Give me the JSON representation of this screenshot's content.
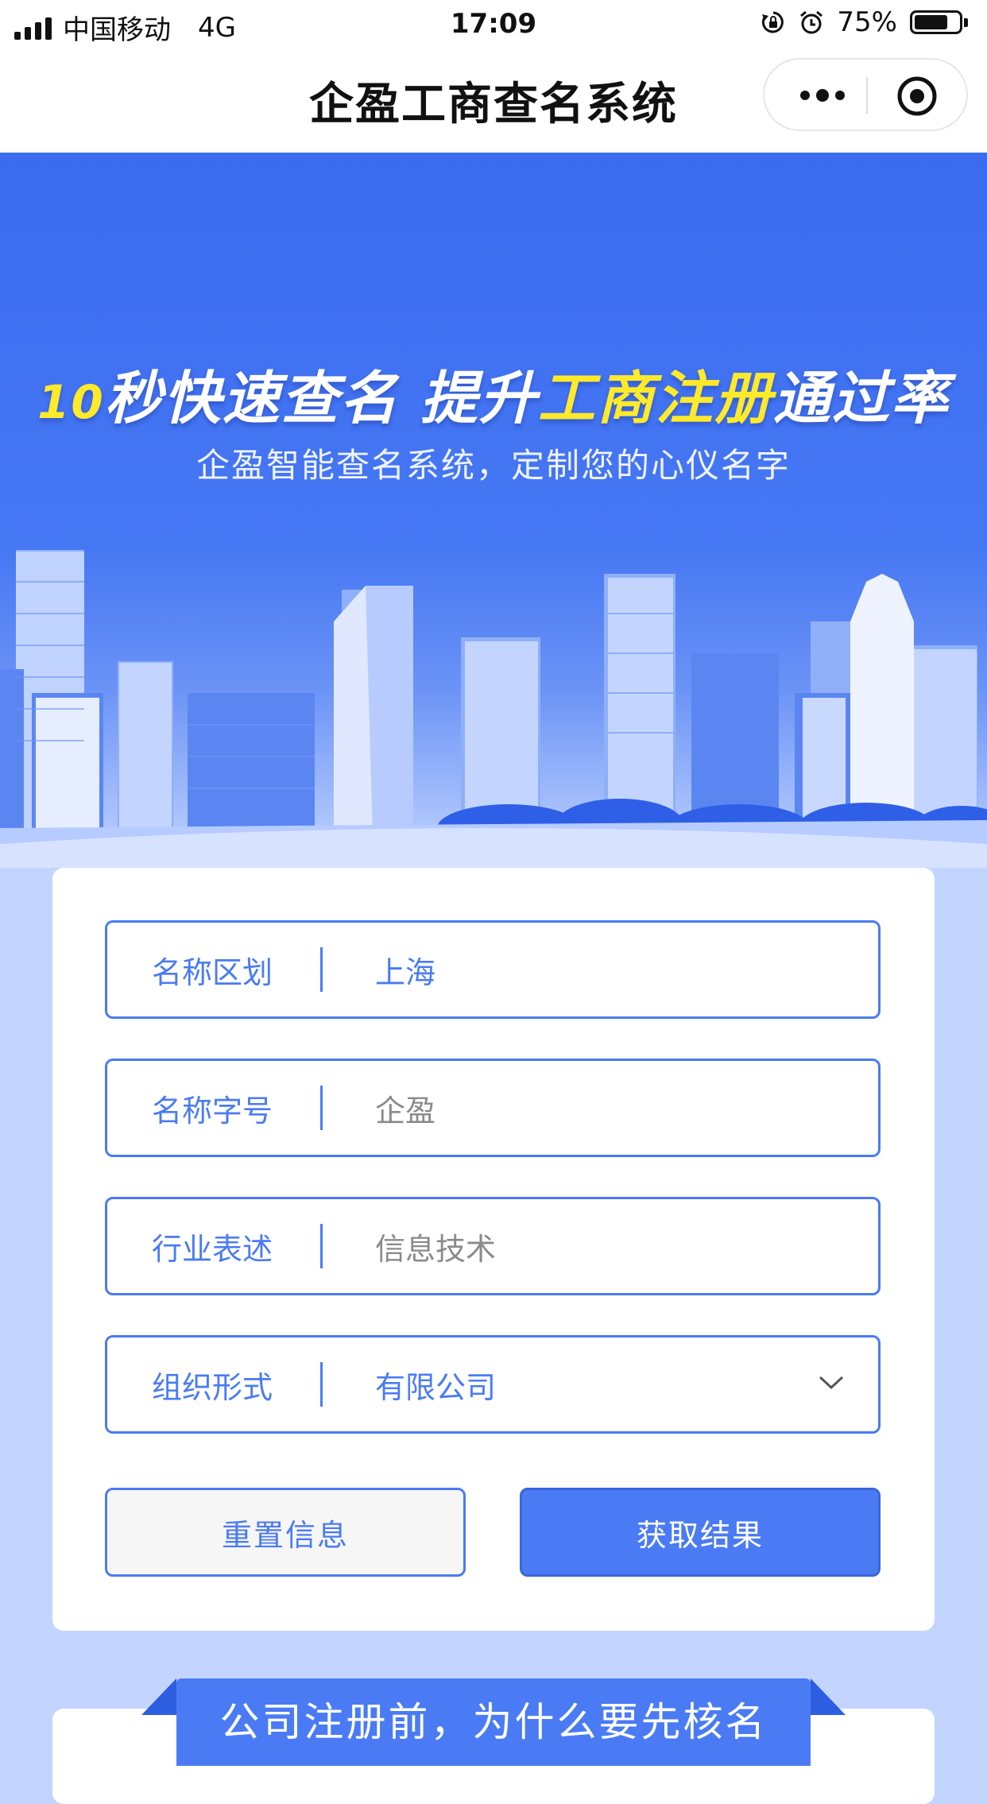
{
  "status_bar": {
    "carrier": "中国移动",
    "network": "4G",
    "time": "17:09",
    "battery": "75%",
    "battery_level": 0.75
  },
  "nav": {
    "title": "企盈工商查名系统",
    "more_icon": "more-dots-icon",
    "close_icon": "target-icon"
  },
  "hero": {
    "headline_num": "10",
    "headline_a": "秒快速查名  提升",
    "headline_highlight": "工商注册",
    "headline_b": "通过率",
    "subtitle": "企盈智能查名系统，定制您的心仪名字",
    "highlight_color": "#ffea2a"
  },
  "form": {
    "fields": [
      {
        "label": "名称区划",
        "value": "上海"
      },
      {
        "label": "名称字号",
        "placeholder": "企盈"
      },
      {
        "label": "行业表述",
        "placeholder": "信息技术"
      },
      {
        "label": "组织形式",
        "value": "有限公司"
      }
    ],
    "reset_label": "重置信息",
    "submit_label": "获取结果"
  },
  "section": {
    "ribbon_title": "公司注册前，为什么要先核名"
  },
  "colors": {
    "primary": "#4a7bf4",
    "hero_blue": "#3b6cf0",
    "page_bg": "#c3d5ff"
  }
}
